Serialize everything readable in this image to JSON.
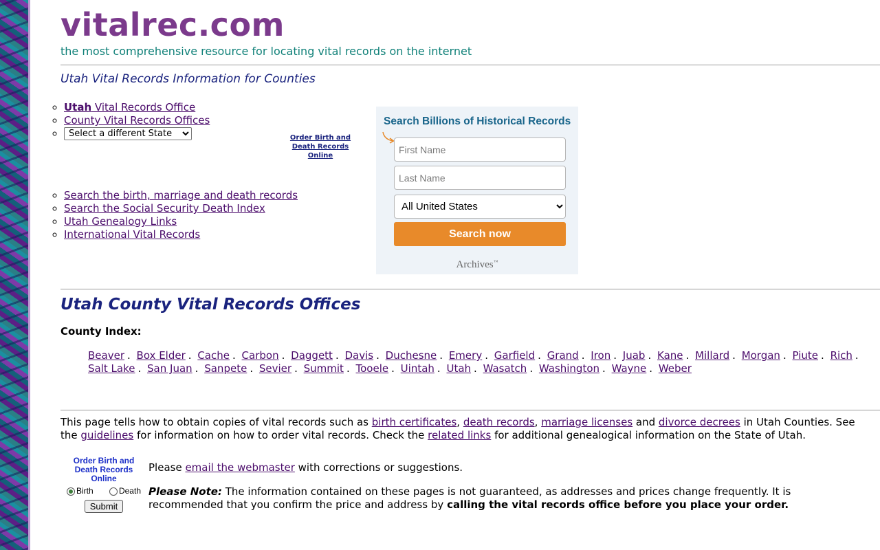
{
  "site": {
    "title": "vitalrec.com",
    "tagline": "the most comprehensive resource for locating vital records on the internet",
    "subheading": "Utah Vital Records Information for Counties"
  },
  "nav_top": {
    "state_bold": "Utah",
    "state_rest": " Vital Records Office",
    "county_offices": "County Vital Records Offices",
    "state_select_value": "Select a different State"
  },
  "order_link": {
    "line1": "Order Birth and",
    "line2": "Death Records Online"
  },
  "nav_bottom": [
    "Search the birth, marriage and death records",
    "Search the Social Security Death Index",
    "Utah Genealogy Links",
    "International Vital Records"
  ],
  "search_widget": {
    "title": "Search Billions of Historical Records",
    "first_name_placeholder": "First Name",
    "last_name_placeholder": "Last Name",
    "location_value": "All United States",
    "button": "Search now",
    "brand": "Archives",
    "brand_mark": "™",
    "accent_color": "#e88a2a"
  },
  "county_section": {
    "heading": "Utah County Vital Records Offices",
    "index_label": "County Index:",
    "counties": [
      "Beaver",
      "Box Elder",
      "Cache",
      "Carbon",
      "Daggett",
      "Davis",
      "Duchesne",
      "Emery",
      "Garfield",
      "Grand",
      "Iron",
      "Juab",
      "Kane",
      "Millard",
      "Morgan",
      "Piute",
      "Rich",
      "Salt Lake",
      "San Juan",
      "Sanpete",
      "Sevier",
      "Summit",
      "Tooele",
      "Uintah",
      "Utah",
      "Wasatch",
      "Washington",
      "Wayne",
      "Weber"
    ],
    "separator": "."
  },
  "intro": {
    "t1": "This page tells how to obtain copies of vital records such as ",
    "l1": "birth certificates",
    "t2": ", ",
    "l2": "death records",
    "t3": ", ",
    "l3": "marriage licenses",
    "t4": " and ",
    "l4": "divorce decrees",
    "t5": " in Utah Counties. See the ",
    "l5": "guidelines",
    "t6": " for information on how to order vital records. Check the ",
    "l6": "related links",
    "t7": " for additional genealogical information on the State of Utah."
  },
  "order_form": {
    "title": "Order Birth and Death Records Online",
    "birth_label": "Birth",
    "death_label": "Death",
    "selected": "Birth",
    "submit": "Submit"
  },
  "contact": {
    "pre": "Please ",
    "link": "email the webmaster",
    "post": " with corrections or suggestions."
  },
  "note": {
    "label": "Please Note:",
    "text": " The information contained on these pages is not guaranteed, as addresses and prices change frequently. It is recommended that you confirm the price and address by ",
    "bold": "calling the vital records office before you place your order."
  }
}
